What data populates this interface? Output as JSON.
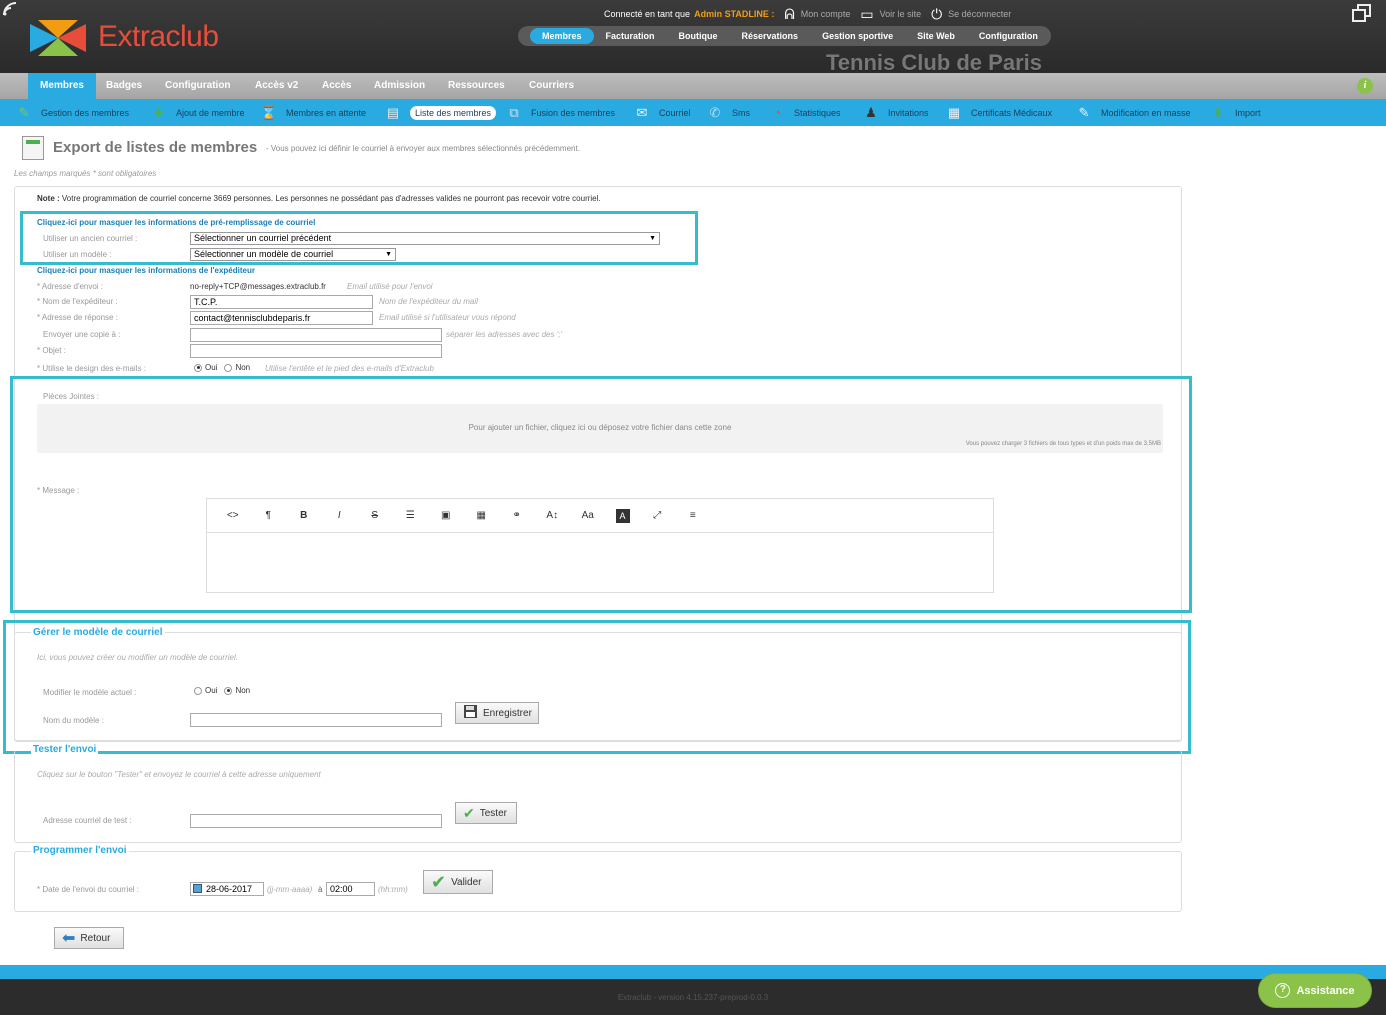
{
  "header": {
    "logo_text": "Extraclub",
    "connected_prefix": "Connecté en tant que",
    "user_name": "Admin STADLINE :",
    "my_account": "Mon compte",
    "view_site": "Voir le site",
    "logout": "Se déconnecter",
    "club_name": "Tennis Club de Paris",
    "top_nav": [
      "Membres",
      "Facturation",
      "Boutique",
      "Réservations",
      "Gestion sportive",
      "Site Web",
      "Configuration"
    ]
  },
  "main_nav": [
    "Membres",
    "Badges",
    "Configuration",
    "Accès v2",
    "Accès",
    "Admission",
    "Ressources",
    "Courriers"
  ],
  "sub_nav": [
    "Gestion des membres",
    "Ajout de membre",
    "Membres en attente",
    "Liste des membres",
    "Fusion des membres",
    "Courriel",
    "Sms",
    "Statistiques",
    "Invitations",
    "Certificats Médicaux",
    "Modification en masse",
    "Import"
  ],
  "page": {
    "title": "Export de listes de membres",
    "subtitle": "- Vous pouvez ici définir le courriel à envoyer aux membres sélectionnés précédemment.",
    "required_note": "Les champs marqués * sont obligatoires"
  },
  "form": {
    "note_label": "Note :",
    "note_text": "Votre programmation de courriel concerne 3669 personnes. Les personnes ne possédant pas d'adresses valides ne pourront pas recevoir votre courriel.",
    "prefill_toggle": "Cliquez-ici pour masquer les informations de pré-remplissage de courriel",
    "old_mail_label": "Utiliser un ancien courriel :",
    "old_mail_value": "Sélectionner un courriel précédent",
    "template_label": "Utiliser un modèle :",
    "template_value": "Sélectionner un modèle de courriel",
    "sender_toggle": "Cliquez-ici pour masquer les informations de l'expéditeur",
    "send_address_label": "* Adresse d'envoi :",
    "send_address_value": "no-reply+TCP@messages.extraclub.fr",
    "send_address_hint": "Email utilisé pour l'envoi",
    "sender_name_label": "* Nom de l'expéditeur :",
    "sender_name_value": "T.C.P.",
    "sender_name_hint": "Nom de l'expéditeur du mail",
    "reply_label": "* Adresse de réponse :",
    "reply_value": "contact@tennisclubdeparis.fr",
    "reply_hint": "Email utilisé si l'utilisateur vous répond",
    "cc_label": "Envoyer une copie à :",
    "cc_value": "",
    "cc_hint": "séparer les adresses avec des ';'",
    "subject_label": "* Objet :",
    "subject_value": "",
    "design_label": "* Utilise le design des e-mails :",
    "oui": "Oui",
    "non": "Non",
    "design_hint": "Utilise l'entête et le pied des e-mails d'Extraclub",
    "attachments_label": "Pièces Jointes :",
    "dropzone_text": "Pour ajouter un fichier, cliquez ici ou déposez votre fichier dans cette zone",
    "dropzone_sub": "Vous pouvez charger 3 fichiers de tous types et d'un poids max de 3.5MB",
    "message_label": "* Message :",
    "message_value": "",
    "toolbar": [
      "<>",
      "¶",
      "B",
      "I",
      "S",
      "☰",
      "▣",
      "▦",
      "⚭",
      "A↕",
      "Aa",
      "A",
      "⤢",
      "≡"
    ]
  },
  "template_section": {
    "legend": "Gérer le modèle de courriel",
    "intro": "Ici, vous pouvez créer ou modifier un modèle de courriel.",
    "modify_label": "Modifier le modèle actuel :",
    "name_label": "Nom du modèle :",
    "name_value": "",
    "save_button": "Enregistrer"
  },
  "test_section": {
    "legend": "Tester l'envoi",
    "intro": "Cliquez sur le bouton \"Tester\" et envoyez le courriel à cette adresse uniquement",
    "address_label": "Adresse courriel de test :",
    "address_value": "",
    "test_button": "Tester"
  },
  "schedule_section": {
    "legend": "Programmer l'envoi",
    "date_label": "* Date de l'envoi du courriel :",
    "date_value": "28-06-2017",
    "date_hint": "(jj-mm-aaaa)",
    "at": "à",
    "time_value": "02:00",
    "time_hint": "(hh:mm)",
    "validate_button": "Valider"
  },
  "back_button": "Retour",
  "footer": {
    "version": "Extraclub - version 4.15.237-preprod-0.0.3",
    "assistance": "Assistance"
  },
  "colors": {
    "accent": "#29abe2",
    "highlight": "#36bccf",
    "brand_red": "#e84d3c",
    "assist_green": "#8bc34a"
  }
}
